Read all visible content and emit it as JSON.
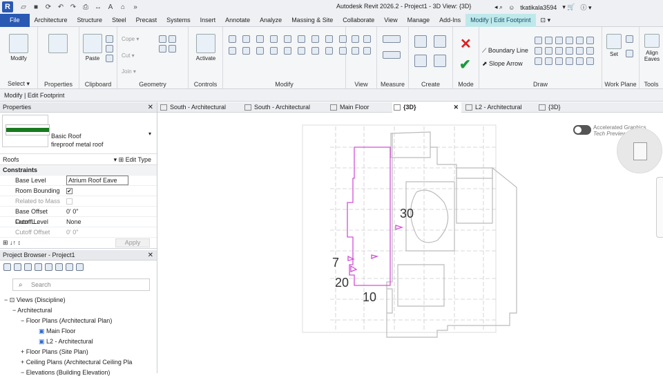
{
  "app": {
    "logo": "R",
    "title": "Autodesk Revit 2026.2 - Project1 - 3D View: {3D}",
    "user": "tkatikala3594"
  },
  "menu": [
    "File",
    "Architecture",
    "Structure",
    "Steel",
    "Precast",
    "Systems",
    "Insert",
    "Annotate",
    "Analyze",
    "Massing & Site",
    "Collaborate",
    "View",
    "Manage",
    "Add-Ins",
    "Modify | Edit Footprint"
  ],
  "ribbon": {
    "panels": [
      "Select ▾",
      "Properties",
      "Clipboard",
      "Geometry",
      "Controls",
      "Modify",
      "View",
      "Measure",
      "Create",
      "Mode",
      "Draw",
      "Work Plane",
      "Tools"
    ],
    "modify_label": "Modify",
    "paste_label": "Paste",
    "activate_label": "Activate",
    "cope_label": "Cope ▾",
    "cut_label": "Cut ▾",
    "join_label": "Join ▾",
    "boundary_line": "Boundary Line",
    "slope_arrow": "Slope Arrow",
    "set_label": "Set",
    "align_label": "Align",
    "eaves_label": "Eaves"
  },
  "options_bar": "Modify | Edit Footprint",
  "properties": {
    "title": "Properties",
    "family": "Basic Roof",
    "type": "fireproof metal roof",
    "category": "Roofs",
    "edit_type": "Edit Type",
    "section": "Constraints",
    "rows": [
      {
        "key": "Base Level",
        "value": "Atrium Roof Eave"
      },
      {
        "key": "Room Bounding",
        "value": "✔"
      },
      {
        "key": "Related to Mass",
        "value": ""
      },
      {
        "key": "Base Offset From L...",
        "value": "0'  0\""
      },
      {
        "key": "Cutoff Level",
        "value": "None"
      },
      {
        "key": "Cutoff Offset",
        "value": "0'  0\""
      }
    ],
    "apply": "Apply"
  },
  "project_browser": {
    "title": "Project Browser - Project1",
    "search_placeholder": "Search",
    "tree": [
      "Views (Discipline)",
      "Architectural",
      "Floor Plans (Architectural Plan)",
      "Main Floor",
      "L2 - Architectural",
      "Floor Plans (Site Plan)",
      "Ceiling Plans (Architectural Ceiling Pla",
      "Elevations (Building Elevation)"
    ]
  },
  "view_tabs": [
    "South - Architectural",
    "South - Architectural",
    "Main Floor",
    "{3D}",
    "L2 - Architectural",
    "{3D}"
  ],
  "canvas": {
    "accelerated_graphics": "Accelerated Graphics",
    "tech_preview": "Tech Preview",
    "slope_labels": [
      "30",
      "7",
      "20",
      "10"
    ],
    "sketch_color": "#d24fd8"
  }
}
